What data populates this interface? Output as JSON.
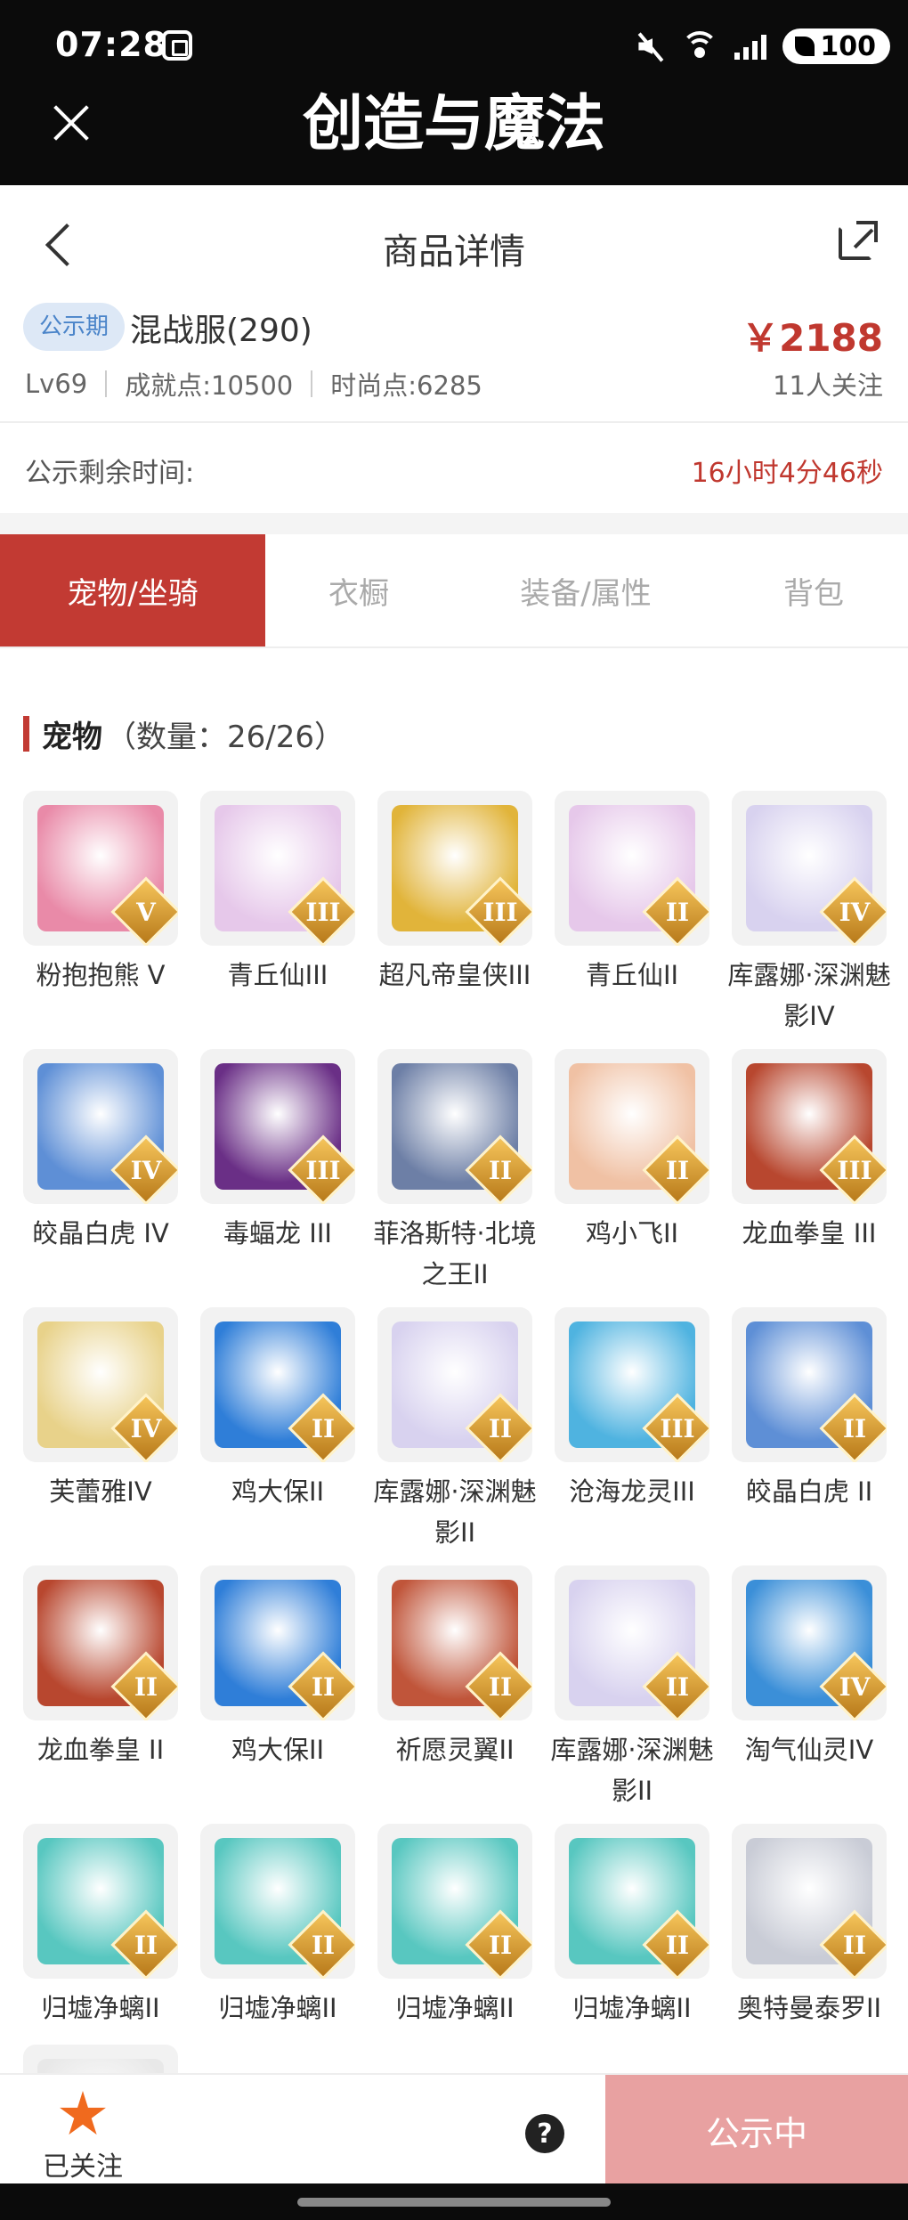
{
  "status_bar": {
    "time": "07:28",
    "battery": "100"
  },
  "app_bar": {
    "title": "创造与魔法"
  },
  "header": {
    "title": "商品详情"
  },
  "product": {
    "badge": "公示期",
    "server": "混战服(290)",
    "price": "￥2188",
    "level": "Lv69",
    "achievement": "成就点:10500",
    "fashion": "时尚点:6285",
    "followers": "11人关注"
  },
  "remaining": {
    "label": "公示剩余时间:",
    "value": "16小时4分46秒"
  },
  "tabs": [
    {
      "label": "宠物/坐骑"
    },
    {
      "label": "衣橱"
    },
    {
      "label": "装备/属性"
    },
    {
      "label": "背包"
    }
  ],
  "section": {
    "title": "宠物",
    "count": "（数量：26/26）"
  },
  "pets": [
    {
      "name": "粉抱抱熊 V",
      "rank": "V",
      "color": "#e98aa8"
    },
    {
      "name": "青丘仙III",
      "rank": "III",
      "color": "#e6c8ea"
    },
    {
      "name": "超凡帝皇侠III",
      "rank": "III",
      "color": "#e1b43a"
    },
    {
      "name": "青丘仙II",
      "rank": "II",
      "color": "#e6c8ea"
    },
    {
      "name": "库露娜·深渊魅影IV",
      "rank": "IV",
      "color": "#d8d2ef"
    },
    {
      "name": "皎晶白虎 IV",
      "rank": "IV",
      "color": "#5e8fd6"
    },
    {
      "name": "毒蝠龙 III",
      "rank": "III",
      "color": "#6a2f86"
    },
    {
      "name": "菲洛斯特·北境之王II",
      "rank": "II",
      "color": "#6d7fa6"
    },
    {
      "name": "鸡小飞II",
      "rank": "II",
      "color": "#f0c1a4"
    },
    {
      "name": "龙血拳皇 III",
      "rank": "III",
      "color": "#b8472f"
    },
    {
      "name": "芙蕾雅IV",
      "rank": "IV",
      "color": "#e8d28a"
    },
    {
      "name": "鸡大保II",
      "rank": "II",
      "color": "#2f7ed8"
    },
    {
      "name": "库露娜·深渊魅影II",
      "rank": "II",
      "color": "#d8d2ef"
    },
    {
      "name": "沧海龙灵III",
      "rank": "III",
      "color": "#4fb3e0"
    },
    {
      "name": "皎晶白虎 II",
      "rank": "II",
      "color": "#5e8fd6"
    },
    {
      "name": "龙血拳皇 II",
      "rank": "II",
      "color": "#b8472f"
    },
    {
      "name": "鸡大保II",
      "rank": "II",
      "color": "#2f7ed8"
    },
    {
      "name": "祈愿灵翼II",
      "rank": "II",
      "color": "#c0553a"
    },
    {
      "name": "库露娜·深渊魅影II",
      "rank": "II",
      "color": "#d8d2ef"
    },
    {
      "name": "淘气仙灵IV",
      "rank": "IV",
      "color": "#3b8fd8"
    },
    {
      "name": "归墟净螭II",
      "rank": "II",
      "color": "#58c7c0"
    },
    {
      "name": "归墟净螭II",
      "rank": "II",
      "color": "#58c7c0"
    },
    {
      "name": "归墟净螭II",
      "rank": "II",
      "color": "#58c7c0"
    },
    {
      "name": "归墟净螭II",
      "rank": "II",
      "color": "#58c7c0"
    },
    {
      "name": "奥特曼泰罗II",
      "rank": "II",
      "color": "#c9ccd6"
    },
    {
      "name": "",
      "rank": "",
      "color": "#e8e8e8"
    }
  ],
  "bottom": {
    "followed": "已关注",
    "help": "?",
    "action": "公示中"
  }
}
